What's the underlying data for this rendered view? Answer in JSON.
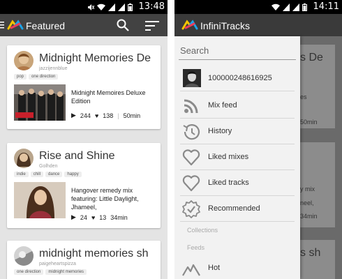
{
  "left_screen": {
    "status": {
      "time": "13:48"
    },
    "appbar": {
      "title": "Featured"
    },
    "cards": [
      {
        "title": "Midnight Memories De",
        "user": "jazzijennblue",
        "tags": [
          "pop",
          "one direction"
        ],
        "description": "Midnight Memoires Deluxe Edition",
        "plays": "244",
        "likes": "138",
        "duration": "50min"
      },
      {
        "title": "Rise and Shine",
        "user": "Golhden",
        "tags": [
          "indie",
          "chill",
          "dance",
          "happy"
        ],
        "description": "Hangover remedy mix featuring: Little Daylight, Jhameel,",
        "plays": "24",
        "likes": "13",
        "duration": "34min"
      },
      {
        "title": "midnight memories sh",
        "user": "paigeheartspizza",
        "tags": [
          "one direction",
          "midnight memories"
        ]
      }
    ]
  },
  "right_screen": {
    "status": {
      "time": "14:11"
    },
    "appbar": {
      "title": "InfiniTracks"
    },
    "search": {
      "placeholder": "Search"
    },
    "user": {
      "name": "100000248616925"
    },
    "menu": [
      {
        "label": "Mix feed",
        "icon": "rss-icon"
      },
      {
        "label": "History",
        "icon": "history-icon"
      },
      {
        "label": "Liked mixes",
        "icon": "heart-icon"
      },
      {
        "label": "Liked tracks",
        "icon": "heart-icon"
      },
      {
        "label": "Recommended",
        "icon": "check-badge-icon"
      }
    ],
    "sections": {
      "collections": "Collections",
      "feeds": "Feeds"
    },
    "feeds": [
      {
        "label": "Hot",
        "icon": "mountain-icon"
      }
    ],
    "background_fragments": [
      "s De",
      "es",
      "50min",
      "y mix",
      "neel,",
      "34min",
      "s sh"
    ]
  },
  "colors": {
    "appbar": "#424242",
    "statusbar": "#000000",
    "background": "#e4e4e4",
    "drawer": "#f2f2f2",
    "icon_gray": "#8a8a8a"
  }
}
